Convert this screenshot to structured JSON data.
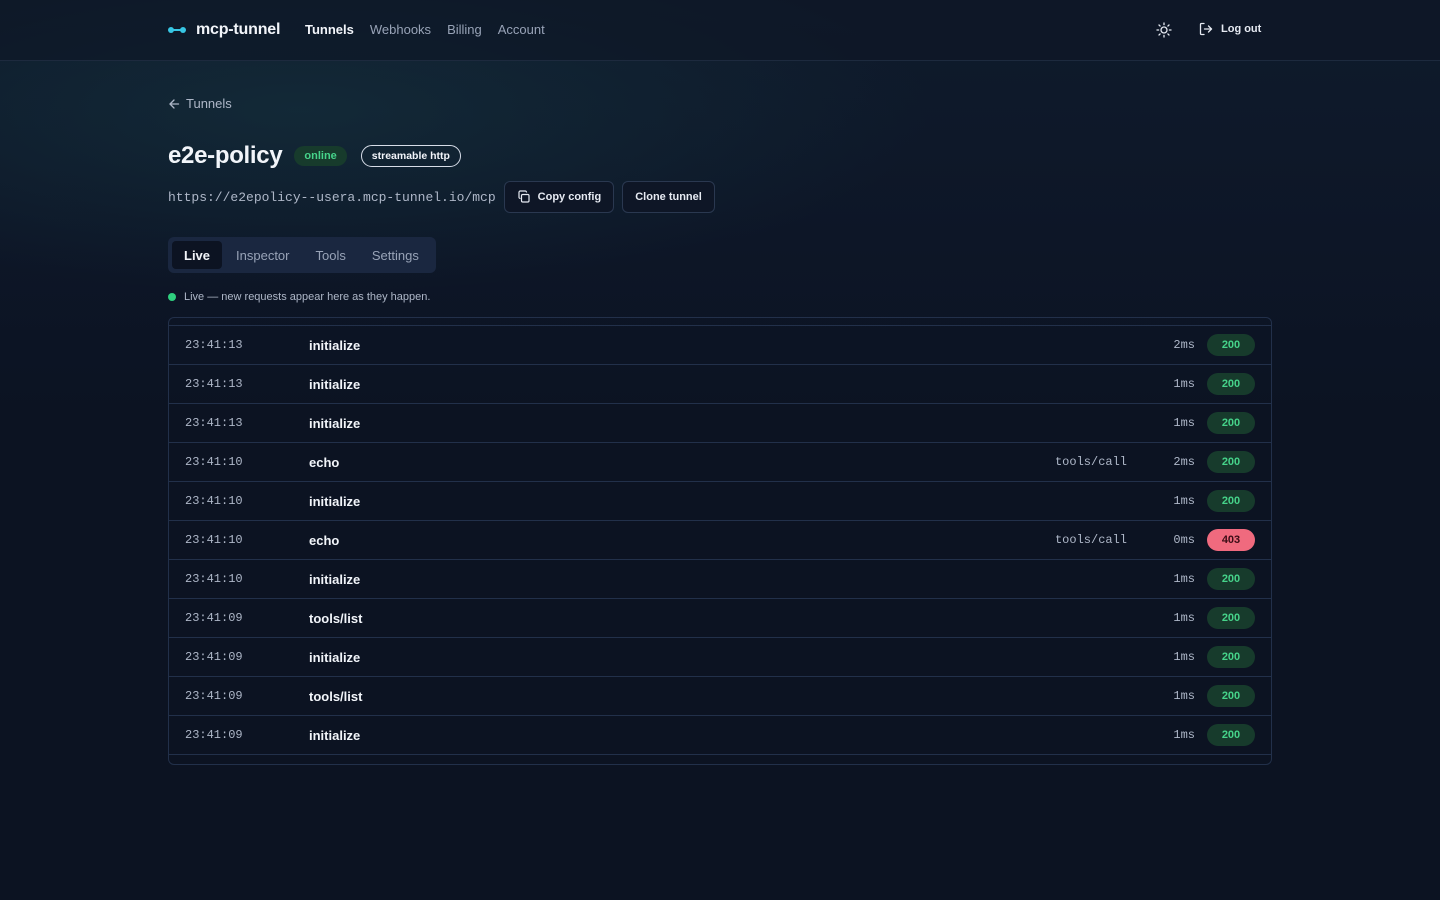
{
  "header": {
    "brand": "mcp-tunnel",
    "nav": [
      "Tunnels",
      "Webhooks",
      "Billing",
      "Account"
    ],
    "active_nav": "Tunnels",
    "logout_label": "Log out"
  },
  "breadcrumb": {
    "back_label": "Tunnels"
  },
  "tunnel": {
    "name": "e2e-policy",
    "status": "online",
    "transport": "streamable http",
    "url": "https://e2epolicy--usera.mcp-tunnel.io/mcp",
    "copy_label": "Copy config",
    "clone_label": "Clone tunnel"
  },
  "tabs": [
    "Live",
    "Inspector",
    "Tools",
    "Settings"
  ],
  "active_tab": "Live",
  "live_note": "Live — new requests appear here as they happen.",
  "requests": [
    {
      "time": "23:41:13",
      "method": "initialize",
      "kind": "",
      "duration": "2ms",
      "status": "200"
    },
    {
      "time": "23:41:13",
      "method": "initialize",
      "kind": "",
      "duration": "1ms",
      "status": "200"
    },
    {
      "time": "23:41:13",
      "method": "initialize",
      "kind": "",
      "duration": "1ms",
      "status": "200"
    },
    {
      "time": "23:41:10",
      "method": "echo",
      "kind": "tools/call",
      "duration": "2ms",
      "status": "200"
    },
    {
      "time": "23:41:10",
      "method": "initialize",
      "kind": "",
      "duration": "1ms",
      "status": "200"
    },
    {
      "time": "23:41:10",
      "method": "echo",
      "kind": "tools/call",
      "duration": "0ms",
      "status": "403"
    },
    {
      "time": "23:41:10",
      "method": "initialize",
      "kind": "",
      "duration": "1ms",
      "status": "200"
    },
    {
      "time": "23:41:09",
      "method": "tools/list",
      "kind": "",
      "duration": "1ms",
      "status": "200"
    },
    {
      "time": "23:41:09",
      "method": "initialize",
      "kind": "",
      "duration": "1ms",
      "status": "200"
    },
    {
      "time": "23:41:09",
      "method": "tools/list",
      "kind": "",
      "duration": "1ms",
      "status": "200"
    },
    {
      "time": "23:41:09",
      "method": "initialize",
      "kind": "",
      "duration": "1ms",
      "status": "200"
    }
  ],
  "colors": {
    "background": "#0c1322",
    "accent": "#37c6e4",
    "success": "#46d38a",
    "error": "#f06a7e"
  },
  "icons": [
    "tunnel-logo-icon",
    "sun-icon",
    "logout-icon",
    "arrow-left-icon",
    "copy-icon",
    "live-dot-icon"
  ]
}
